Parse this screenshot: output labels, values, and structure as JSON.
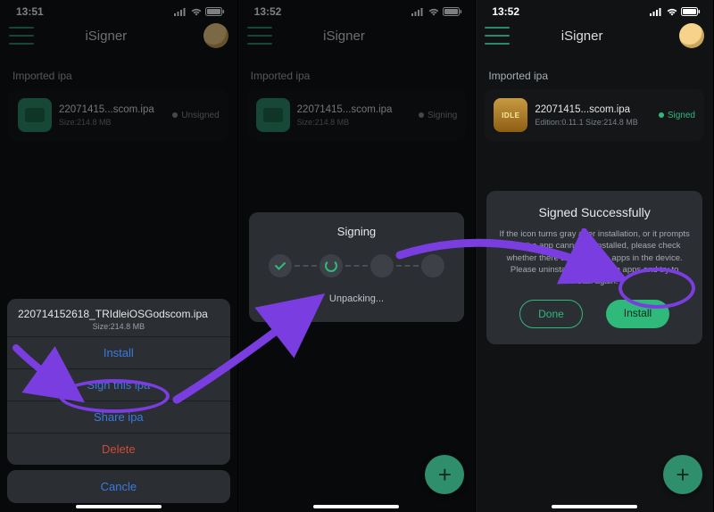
{
  "app_title": "iSigner",
  "status_bar": {
    "time1": "13:51",
    "time2": "13:52",
    "time3": "13:52"
  },
  "section_label": "Imported ipa",
  "ipa": {
    "short_name": "22071415...scom.ipa",
    "full_name": "220714152618_TRIdleiOSGodscom.ipa",
    "size": "Size:214.8 MB",
    "size_short": "214.8 MB",
    "edition": "Edition:0.11.1  Size:214.8 MB"
  },
  "statuses": {
    "unsigned": "Unsigned",
    "signing": "Signing",
    "signed": "Signed"
  },
  "sheet": {
    "install": "Install",
    "sign": "Sign this ipa",
    "share": "Share ipa",
    "delete": "Delete",
    "cancel": "Cancle"
  },
  "sign_modal": {
    "title": "Signing",
    "status": "Unpacking..."
  },
  "success": {
    "title": "Signed Successfully",
    "body": "If the icon turns gray after installation, or it prompts that the app cannot be installed, please check whether there are duplicate apps in the device. Please uninstall the duplicate apps and try to install again.",
    "done": "Done",
    "install": "Install"
  },
  "game_icon_label": "IDLE"
}
